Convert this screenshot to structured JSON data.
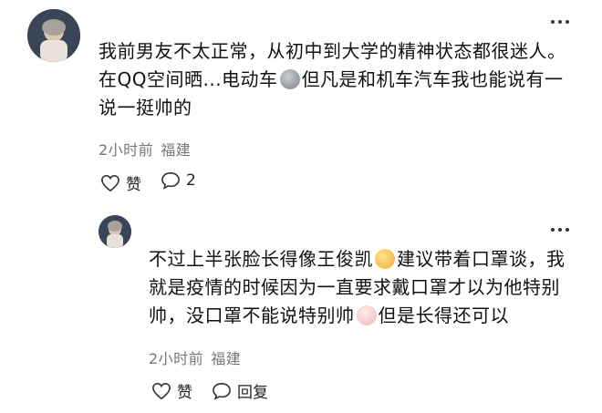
{
  "comments": [
    {
      "text_parts": [
        "我前男友不太正常，从初中到大学的精神状态都很迷人。在QQ空间晒...电动车",
        "但凡是和机车汽车我也能说有一说一挺帅的"
      ],
      "emoji_names": [
        "money-face-emoji"
      ],
      "time": "2小时前",
      "location": "福建",
      "like_label": "赞",
      "reply_count": "2"
    },
    {
      "text_parts": [
        "不过上半张脸长得像王俊凯",
        "建议带着口罩谈，我就是疫情的时候因为一直要求戴口罩才以为他特别帅，没口罩不能说特别帅",
        "但是长得还可以"
      ],
      "emoji_names": [
        "smile-emoji",
        "crying-laughing-emoji"
      ],
      "time": "2小时前",
      "location": "福建",
      "like_label": "赞",
      "reply_label": "回复"
    }
  ]
}
